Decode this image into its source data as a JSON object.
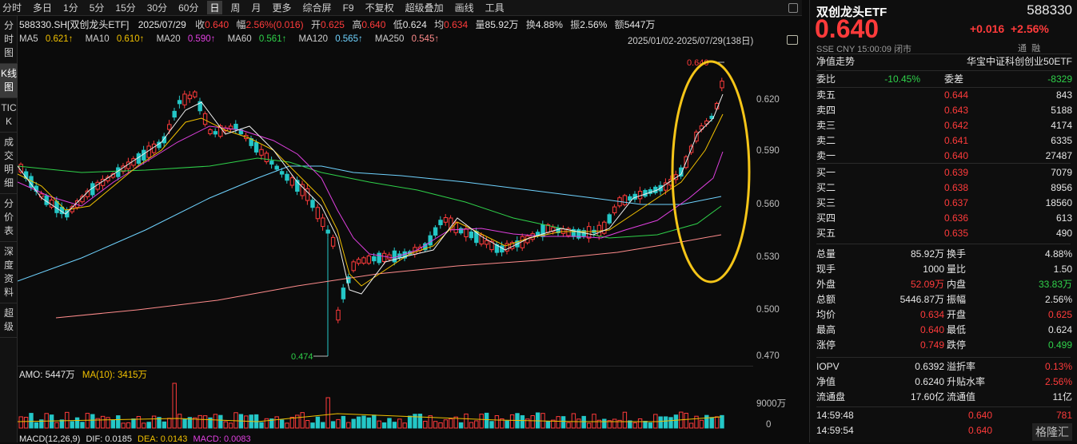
{
  "toolbar": {
    "tabs": [
      "分时",
      "多日",
      "1分",
      "5分",
      "15分",
      "30分",
      "60分"
    ],
    "code_name": "588330.SH[双创龙头ETF]",
    "date": "2025/07/29",
    "close_label": "收",
    "close_val": "0.640",
    "amp_label": "幅",
    "amp_val": "2.56%(0.016)",
    "open_label": "开",
    "open_val": "0.625",
    "high_label": "高",
    "high_val": "0.640",
    "low_label": "低",
    "low_val": "0.624",
    "avg_label": "均",
    "avg_val": "0.634",
    "amount_label": "量",
    "amount_val": "85.92万",
    "turnover_label": "换",
    "turnover_val": "4.88%",
    "swing_label": "振",
    "swing_val": "2.56%",
    "value_label": "额",
    "value_val": "5447万",
    "period_day": "日",
    "period_week": "周",
    "period_month": "月",
    "more": "更多",
    "right_items": [
      "综合屏",
      "F9",
      "不复权",
      "超级叠加",
      "画线",
      "工具"
    ]
  },
  "sidenav": [
    "分时图",
    "K线图",
    "TICK",
    "成交明细",
    "分价表",
    "深度资料",
    "超级"
  ],
  "ma": [
    {
      "label": "MA5",
      "val": "0.621↑",
      "color": "#f0f0f0"
    },
    {
      "label": "MA10",
      "val": "0.610↑",
      "color": "#f0c000"
    },
    {
      "label": "MA20",
      "val": "0.590↑",
      "color": "#e040e0"
    },
    {
      "label": "MA60",
      "val": "0.561↑",
      "color": "#2fd14a"
    },
    {
      "label": "MA120",
      "val": "0.565↑",
      "color": "#6fd3ff"
    },
    {
      "label": "MA250",
      "val": "0.545↑",
      "color": "#ff8c8c"
    }
  ],
  "range_label": "2025/01/02-2025/07/29(138日)",
  "chart": {
    "y_ticks": [
      "0.620",
      "0.590",
      "0.560",
      "0.530",
      "0.500",
      "0.470"
    ],
    "high_marker": "0.640",
    "low_marker": "0.474",
    "vol_ticks": [
      "9000万",
      "0"
    ]
  },
  "amo": {
    "label": "AMO: 5447万",
    "ma_label": "MA(10): 3415万"
  },
  "macd": {
    "label": "MACD(12,26,9)",
    "dif": "DIF: 0.0185",
    "dea": "DEA: 0.0143",
    "macd": "MACD: 0.0083"
  },
  "quote": {
    "name": "双创龙头ETF",
    "code": "588330",
    "price": "0.640",
    "change": "+0.016",
    "pct": "+2.56%",
    "meta": [
      "SSE",
      "CNY",
      "15:00:09",
      "闭市"
    ],
    "tags": [
      "通",
      "融"
    ],
    "nav_label": "净值走势",
    "index_name": "华宝中证科创创业50ETF",
    "wei_bi_label": "委比",
    "wei_bi": "-10.45%",
    "wei_cha_label": "委差",
    "wei_cha": "-8329",
    "asks": [
      {
        "label": "卖五",
        "price": "0.644",
        "vol": "843"
      },
      {
        "label": "卖四",
        "price": "0.643",
        "vol": "5188"
      },
      {
        "label": "卖三",
        "price": "0.642",
        "vol": "4174"
      },
      {
        "label": "卖二",
        "price": "0.641",
        "vol": "6335"
      },
      {
        "label": "卖一",
        "price": "0.640",
        "vol": "27487"
      }
    ],
    "bids": [
      {
        "label": "买一",
        "price": "0.639",
        "vol": "7079"
      },
      {
        "label": "买二",
        "price": "0.638",
        "vol": "8956"
      },
      {
        "label": "买三",
        "price": "0.637",
        "vol": "18560"
      },
      {
        "label": "买四",
        "price": "0.636",
        "vol": "613"
      },
      {
        "label": "买五",
        "price": "0.635",
        "vol": "490"
      }
    ],
    "stats": [
      {
        "l1": "总量",
        "v1": "85.92万",
        "c1": "white",
        "l2": "换手",
        "v2": "4.88%",
        "c2": "white"
      },
      {
        "l1": "现手",
        "v1": "1000",
        "c1": "white",
        "l2": "量比",
        "v2": "1.50",
        "c2": "white"
      },
      {
        "l1": "外盘",
        "v1": "52.09万",
        "c1": "red",
        "l2": "内盘",
        "v2": "33.83万",
        "c2": "green"
      },
      {
        "l1": "总额",
        "v1": "5446.87万",
        "c1": "white",
        "l2": "振幅",
        "v2": "2.56%",
        "c2": "white"
      },
      {
        "l1": "均价",
        "v1": "0.634",
        "c1": "red",
        "l2": "开盘",
        "v2": "0.625",
        "c2": "red"
      },
      {
        "l1": "最高",
        "v1": "0.640",
        "c1": "red",
        "l2": "最低",
        "v2": "0.624",
        "c2": "white"
      },
      {
        "l1": "涨停",
        "v1": "0.749",
        "c1": "red",
        "l2": "跌停",
        "v2": "0.499",
        "c2": "green"
      }
    ],
    "stats2": [
      {
        "l1": "IOPV",
        "v1": "0.6392",
        "c1": "white",
        "l2": "溢折率",
        "v2": "0.13%",
        "c2": "red"
      },
      {
        "l1": "净值",
        "v1": "0.6240",
        "c1": "white",
        "l2": "升贴水率",
        "v2": "2.56%",
        "c2": "red"
      },
      {
        "l1": "流通盘",
        "v1": "17.60亿",
        "c1": "white",
        "l2": "流通值",
        "v2": "11亿",
        "c2": "white"
      }
    ],
    "ticks": [
      {
        "time": "14:59:48",
        "price": "0.640",
        "vol": "781"
      },
      {
        "time": "14:59:54",
        "price": "0.640",
        "vol": "1"
      }
    ],
    "watermark": "格隆汇"
  },
  "colors": {
    "up": "#ff3b3b",
    "down": "#24c7c7",
    "highlight": "#f5c518"
  }
}
